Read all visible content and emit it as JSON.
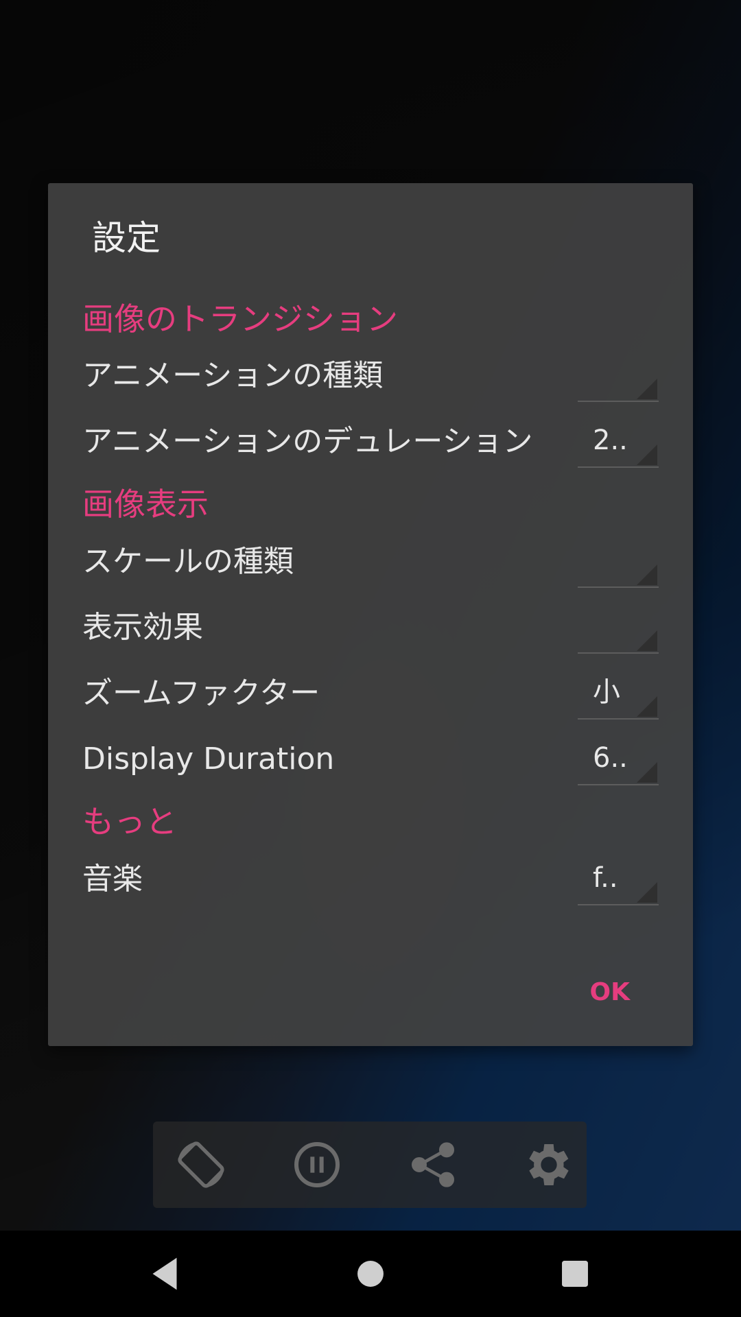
{
  "dialog": {
    "title": "設定",
    "sections": [
      {
        "header": "画像のトランジション"
      },
      {
        "header": "画像表示"
      },
      {
        "header": "もっと"
      }
    ],
    "rows": [
      {
        "label": "アニメーションの種類",
        "value": ""
      },
      {
        "label": "アニメーションのデュレーション",
        "value": "2.."
      },
      {
        "label": "スケールの種類",
        "value": ""
      },
      {
        "label": "表示効果",
        "value": ""
      },
      {
        "label": "ズームファクター",
        "value": "小"
      },
      {
        "label": "Display Duration",
        "value": "6.."
      },
      {
        "label": "音楽",
        "value": "f.."
      }
    ],
    "ok_label": "OK"
  },
  "controls": {
    "icons": [
      "screen-rotation-icon",
      "pause-icon",
      "share-icon",
      "settings-gear-icon"
    ]
  },
  "navbar": {
    "icons": [
      "back-icon",
      "home-icon",
      "recents-icon"
    ]
  },
  "colors": {
    "accent": "#e63d7f",
    "dialog_bg": "#424242",
    "text": "#e8e8e8"
  }
}
